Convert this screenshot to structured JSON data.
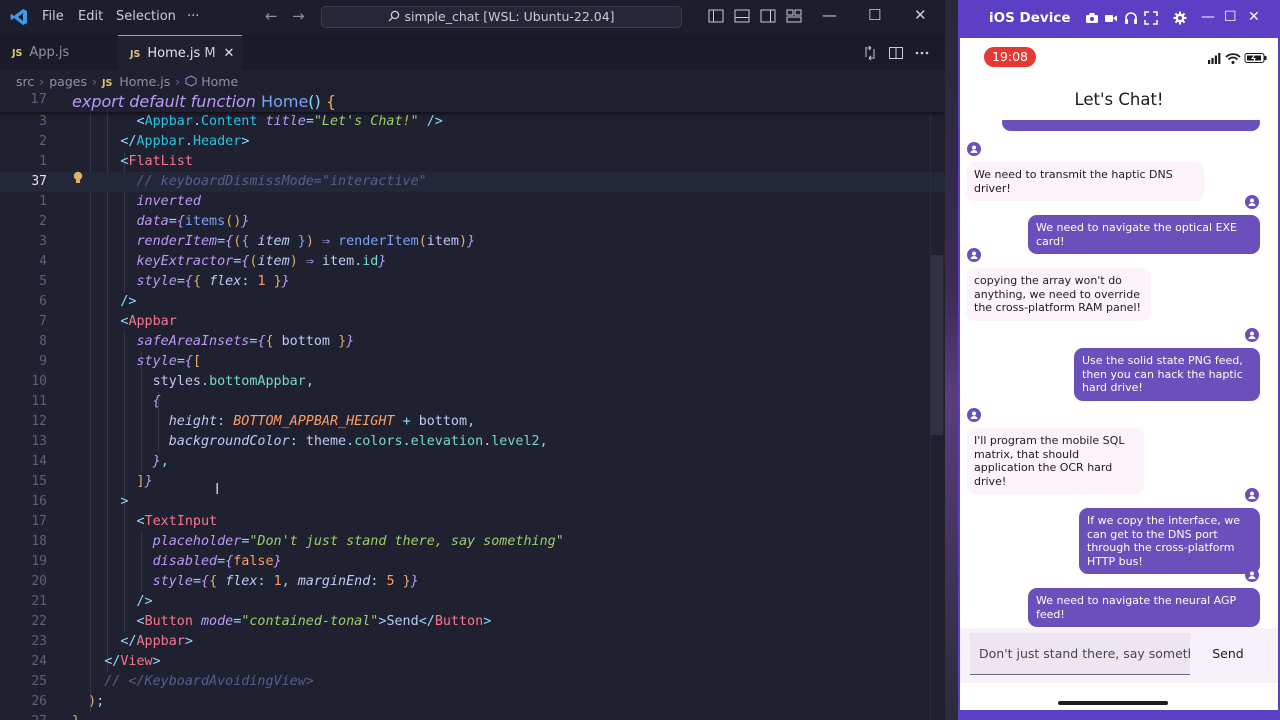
{
  "vscode": {
    "menu": [
      "File",
      "Edit",
      "Selection",
      "···"
    ],
    "command_center": "simple_chat [WSL: Ubuntu-22.04]",
    "tabs": [
      {
        "badge": "JS",
        "label": "App.js",
        "modified": "",
        "active": false
      },
      {
        "badge": "JS",
        "label": "Home.js",
        "modified": "M",
        "active": true
      }
    ],
    "tab_close": "✕",
    "breadcrumb": [
      "src",
      "pages",
      "Home.js",
      "Home"
    ],
    "breadcrumb_js": "JS",
    "sticky_line": {
      "number": "17",
      "text": "export default function Home() {"
    },
    "line_numbers": [
      "3",
      "2",
      "1",
      "37",
      "1",
      "2",
      "3",
      "4",
      "5",
      "6",
      "7",
      "8",
      "9",
      "10",
      "11",
      "12",
      "13",
      "14",
      "15",
      "16",
      "17",
      "18",
      "19",
      "20",
      "21",
      "22",
      "23",
      "24",
      "25",
      "26",
      "27"
    ],
    "current_line_index": 3
  },
  "ios": {
    "window_title": "iOS Device",
    "time": "19:08",
    "header_title": "Let's Chat!",
    "messages": [
      {
        "side": "in",
        "text": "We need to transmit the haptic DNS driver!"
      },
      {
        "side": "out",
        "text": "We need to navigate the optical EXE card!"
      },
      {
        "side": "in",
        "text": "copying the array won't do anything, we need to override the cross-platform RAM panel!"
      },
      {
        "side": "out",
        "text": "Use the solid state PNG feed, then you can hack the haptic hard drive!"
      },
      {
        "side": "in",
        "text": "I'll program the mobile SQL matrix, that should application the OCR hard drive!"
      },
      {
        "side": "out",
        "text": "If we copy the interface, we can get to the DNS port through the cross-platform HTTP bus!"
      },
      {
        "side": "out",
        "text": "We need to navigate the neural AGP feed!"
      }
    ],
    "input_placeholder": "Don't just stand there, say something",
    "input_visible_text": "Don't just stand there, say someth",
    "send_label": "Send"
  },
  "colors": {
    "accent": "#7aa2f7",
    "ios_purple": "#5b3fc4",
    "bubble_out": "#6b4fbb",
    "bubble_in": "#fdf3fb",
    "time_pill": "#e53935"
  },
  "icons": [
    "vscode-logo-icon",
    "back-arrow-icon",
    "forward-arrow-icon",
    "search-icon",
    "toggle-sidebar-icon",
    "toggle-panel-icon",
    "toggle-secondary-sidebar-icon",
    "customize-layout-icon",
    "minimize-icon",
    "maximize-icon",
    "close-icon",
    "compare-changes-icon",
    "split-editor-icon",
    "more-actions-icon",
    "lightbulb-icon",
    "camera-icon",
    "video-icon",
    "headphones-icon",
    "fullscreen-icon",
    "gear-icon",
    "signal-icon",
    "wifi-icon",
    "battery-icon",
    "avatar-icon"
  ]
}
